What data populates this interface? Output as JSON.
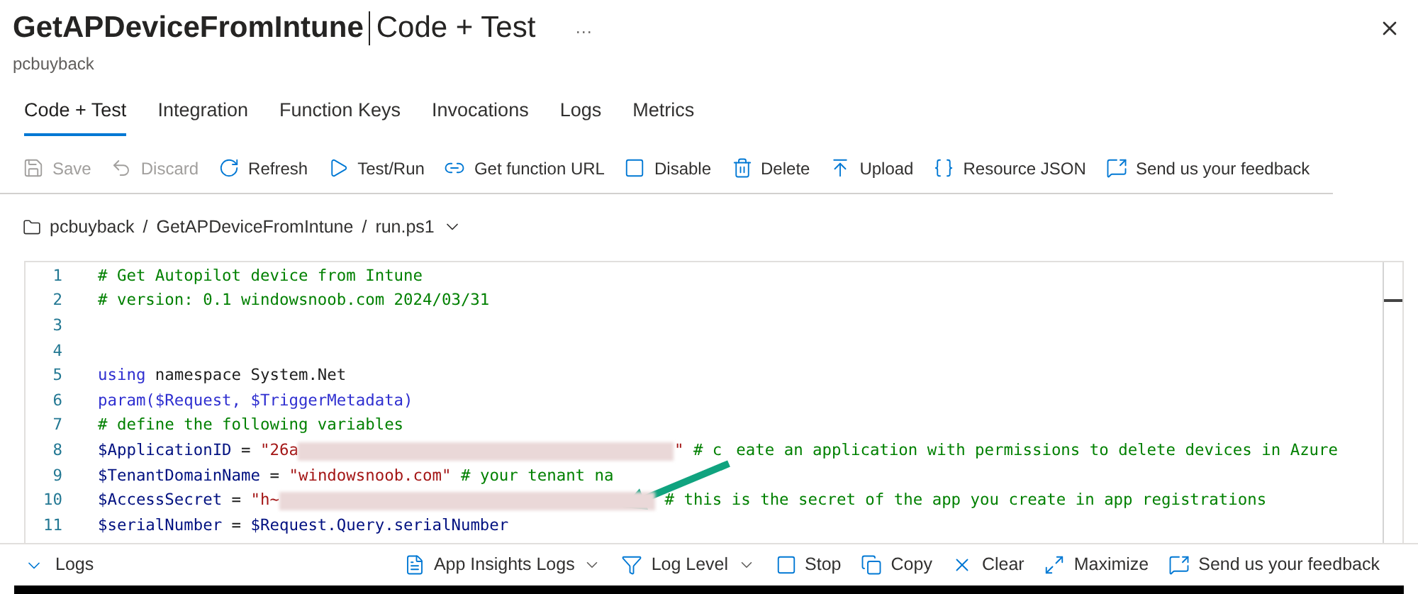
{
  "header": {
    "title": "GetAPDeviceFromIntune",
    "section": "Code + Test",
    "more": "···",
    "subtitle": "pcbuyback"
  },
  "tabs": [
    {
      "label": "Code + Test",
      "selected": true
    },
    {
      "label": "Integration",
      "selected": false
    },
    {
      "label": "Function Keys",
      "selected": false
    },
    {
      "label": "Invocations",
      "selected": false
    },
    {
      "label": "Logs",
      "selected": false
    },
    {
      "label": "Metrics",
      "selected": false
    }
  ],
  "toolbar": [
    {
      "kind": "save",
      "label": "Save",
      "disabled": true
    },
    {
      "kind": "discard",
      "label": "Discard",
      "disabled": true
    },
    {
      "kind": "refresh",
      "label": "Refresh",
      "disabled": false
    },
    {
      "kind": "run",
      "label": "Test/Run",
      "disabled": false
    },
    {
      "kind": "link",
      "label": "Get function URL",
      "disabled": false
    },
    {
      "kind": "checkbox",
      "label": "Disable",
      "disabled": false
    },
    {
      "kind": "delete",
      "label": "Delete",
      "disabled": false
    },
    {
      "kind": "upload",
      "label": "Upload",
      "disabled": false
    },
    {
      "kind": "json",
      "label": "Resource JSON",
      "disabled": false
    },
    {
      "kind": "feedback",
      "label": "Send us your feedback",
      "disabled": false
    }
  ],
  "breadcrumb": {
    "separator": "/",
    "items": [
      "pcbuyback",
      "GetAPDeviceFromIntune",
      "run.ps1"
    ]
  },
  "code": [
    {
      "number": "1",
      "tokens": [
        {
          "kind": "comment",
          "text": "# Get Autopilot device from Intune"
        }
      ]
    },
    {
      "number": "2",
      "tokens": [
        {
          "kind": "comment",
          "text": "# version: 0.1 windowsnoob.com 2024/03/31"
        }
      ]
    },
    {
      "number": "3"
    },
    {
      "number": "4"
    },
    {
      "number": "5",
      "tokens": [
        {
          "kind": "keyword",
          "text": "using"
        },
        {
          "kind": "plain",
          "text": " namespace System.Net"
        }
      ]
    },
    {
      "number": "6",
      "tokens": [
        {
          "kind": "keyword",
          "text": "param($Request, $TriggerMetadata)"
        }
      ]
    },
    {
      "number": "7",
      "tokens": [
        {
          "kind": "comment",
          "text": "# define the following variables"
        }
      ]
    },
    {
      "number": "8",
      "tokens": [
        {
          "kind": "variable",
          "text": "$ApplicationID"
        },
        {
          "kind": "plain",
          "text": " = "
        },
        {
          "kind": "string",
          "text": "\"26a"
        },
        {
          "kind": "redacted"
        },
        {
          "kind": "string",
          "text": "\""
        },
        {
          "kind": "comment",
          "text": " # c"
        },
        {
          "kind": "arrow"
        },
        {
          "kind": "comment",
          "text": "eate an application with permissions to delete devices in Azure"
        }
      ]
    },
    {
      "number": "9",
      "tokens": [
        {
          "kind": "variable",
          "text": "$TenantDomainName"
        },
        {
          "kind": "plain",
          "text": " = "
        },
        {
          "kind": "string",
          "text": "\"windowsnoob.com\""
        },
        {
          "kind": "comment",
          "text": " # your tenant na"
        }
      ]
    },
    {
      "number": "10",
      "tokens": [
        {
          "kind": "variable",
          "text": "$AccessSecret"
        },
        {
          "kind": "plain",
          "text": " = "
        },
        {
          "kind": "string",
          "text": "\"h~"
        },
        {
          "kind": "redacted"
        },
        {
          "kind": "comment",
          "text": " # this is the secret of the app you create in app registrations"
        }
      ]
    },
    {
      "number": "11",
      "tokens": [
        {
          "kind": "variable",
          "text": "$serialNumber"
        },
        {
          "kind": "plain",
          "text": " = "
        },
        {
          "kind": "variable",
          "text": "$Request.Query.serialNumber"
        }
      ]
    }
  ],
  "logs_bar": {
    "title": "Logs",
    "actions": [
      {
        "kind": "insights",
        "label": "App Insights Logs",
        "dropdown": true
      },
      {
        "kind": "filter",
        "label": "Log Level",
        "dropdown": true
      },
      {
        "kind": "stop",
        "label": "Stop",
        "dropdown": false
      },
      {
        "kind": "copy",
        "label": "Copy",
        "dropdown": false
      },
      {
        "kind": "clear",
        "label": "Clear",
        "dropdown": false
      },
      {
        "kind": "maximize",
        "label": "Maximize",
        "dropdown": false
      },
      {
        "kind": "feedback",
        "label": "Send us your feedback",
        "dropdown": false
      }
    ]
  }
}
